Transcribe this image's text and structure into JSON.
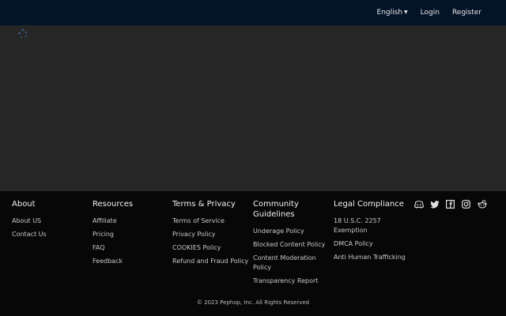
{
  "header": {
    "language_label": "English",
    "login_label": "Login",
    "register_label": "Register"
  },
  "footer": {
    "about": {
      "title": "About",
      "links": [
        "About US",
        "Contact Us"
      ]
    },
    "resources": {
      "title": "Resources",
      "links": [
        "Affiliate",
        "Pricing",
        "FAQ",
        "Feedback"
      ]
    },
    "terms": {
      "title": "Terms & Privacy",
      "links": [
        "Terms of Service",
        "Privacy Policy",
        "COOKIES Policy",
        "Refund and Fraud Policy"
      ]
    },
    "community": {
      "title": "Community Guidelines",
      "links": [
        "Underage Policy",
        "Blocked Content Policy",
        "Content Moderation Policy",
        "Transparency Report"
      ]
    },
    "legal": {
      "title": "Legal Compliance",
      "links": [
        "18 U.S.C. 2257 Exemption",
        "DMCA Policy",
        "Anti Human Trafficking"
      ]
    },
    "socials": [
      "discord-icon",
      "twitter-icon",
      "facebook-icon",
      "instagram-icon",
      "reddit-icon"
    ],
    "copyright": "© 2023 Pephop, Inc. All Rights Reserved"
  },
  "colors": {
    "header_bg": "#041428",
    "body_bg": "#262626",
    "footer_bg": "#070707"
  }
}
